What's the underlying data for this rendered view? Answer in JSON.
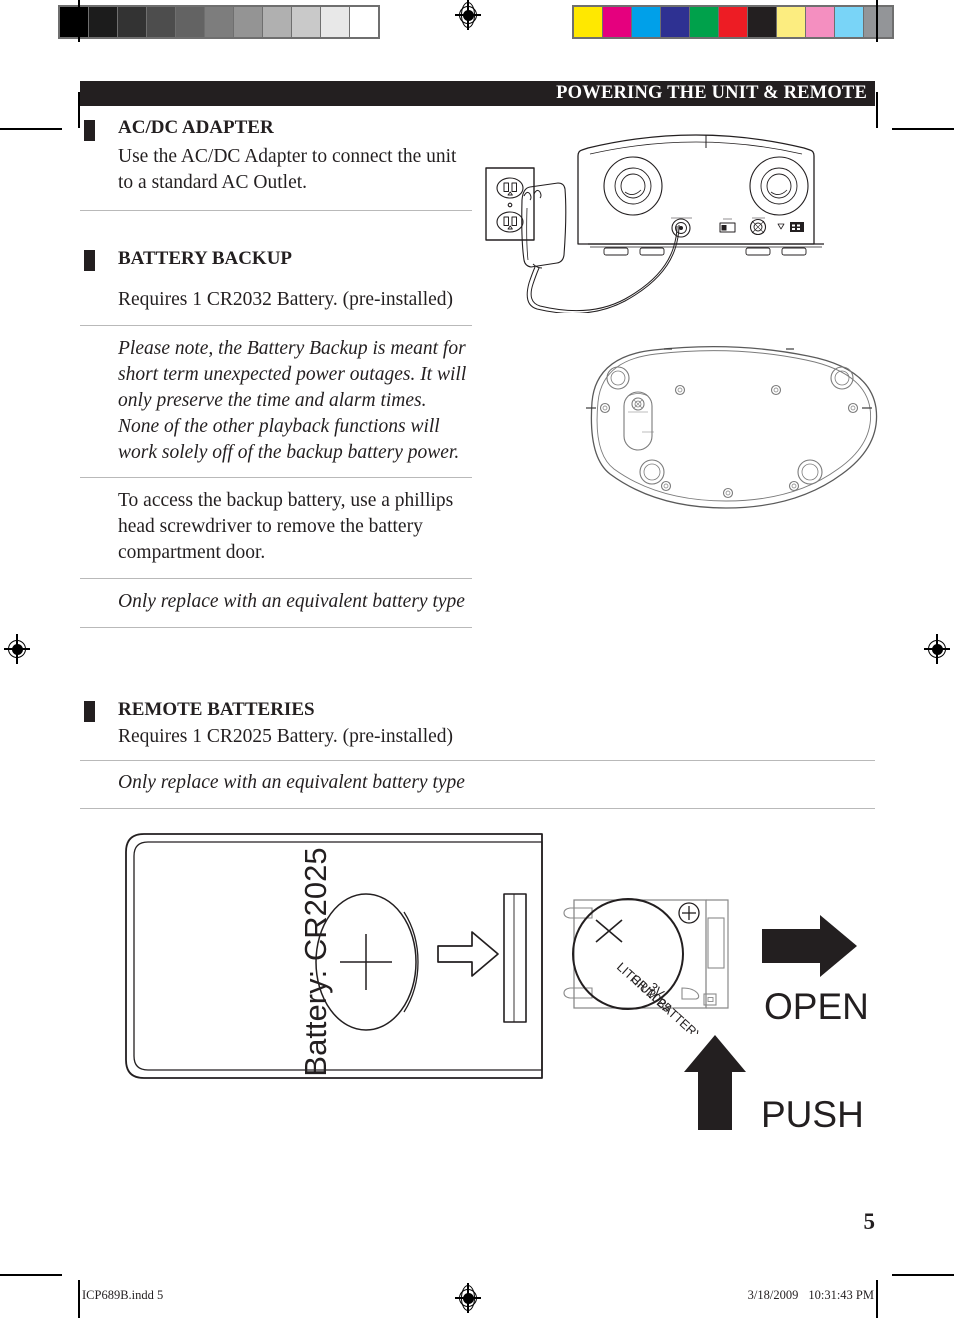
{
  "header": {
    "title": "POWERING THE UNIT & REMOTE"
  },
  "calibration": {
    "grayscale_swatches": [
      "#000000",
      "#1c1c1c",
      "#333333",
      "#4d4d4d",
      "#636363",
      "#7d7d7d",
      "#949494",
      "#b0b0b0",
      "#c9c9c9",
      "#e8e8e8",
      "#ffffff"
    ],
    "color_swatches": [
      "#ffe800",
      "#e5007e",
      "#00a0e9",
      "#2e3192",
      "#00a14b",
      "#ed1c24",
      "#231f20",
      "#fced80",
      "#f48fc0",
      "#79d4f7",
      "#939598"
    ]
  },
  "sections": [
    {
      "id": "ac-dc-adapter",
      "heading": "AC/DC ADAPTER",
      "blocks": [
        {
          "style": "roman",
          "text": "Use the AC/DC Adapter to connect the unit to a standard AC Outlet."
        }
      ]
    },
    {
      "id": "battery-backup",
      "heading": "BATTERY BACKUP",
      "blocks": [
        {
          "style": "roman",
          "text": "Requires 1 CR2032 Battery. (pre-installed)"
        },
        {
          "style": "italic",
          "text": "Please note, the Battery Backup is meant for short term unexpected power outages. It will only preserve the time and alarm times. None of the other playback functions will work solely off of the backup battery power."
        },
        {
          "style": "roman",
          "text": "To access the backup battery, use a phillips head screwdriver to remove the battery compartment door."
        },
        {
          "style": "italic",
          "text": "Only replace with an equivalent battery type"
        }
      ]
    }
  ],
  "remote_section": {
    "id": "remote-batteries",
    "heading": "REMOTE BATTERIES",
    "blocks": [
      {
        "style": "roman",
        "text": "Requires 1 CR2025 Battery. (pre-installed)"
      },
      {
        "style": "italic",
        "text": "Only replace with an equivalent battery type"
      }
    ]
  },
  "illustrations": {
    "rear_panel": {
      "name": "unit-rear-with-adapter",
      "caption": ""
    },
    "unit_bottom": {
      "name": "unit-bottom-battery-door",
      "caption": ""
    },
    "remote_back": {
      "name": "remote-back-battery-door",
      "label": "Battery: CR2025"
    },
    "coin_cell": {
      "name": "coin-cell-detail",
      "line1": "LITHIUM BATTERY",
      "line2": "CR 2025",
      "line3": "3V",
      "polarity": "+"
    }
  },
  "callouts": {
    "open": "OPEN",
    "push": "PUSH"
  },
  "folio": {
    "page_number": "5"
  },
  "colophon": {
    "file_and_page": "ICP689B.indd   5",
    "date": "3/18/2009",
    "time": "10:31:43 PM"
  }
}
